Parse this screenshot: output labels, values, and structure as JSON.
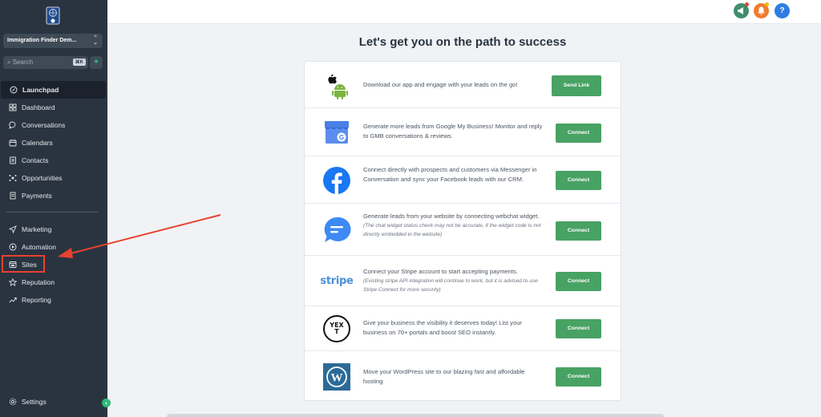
{
  "sidebar": {
    "account_name": "Immigration Finder Dem...",
    "search_placeholder": "Search",
    "search_shortcut": "⌘K",
    "nav_primary": [
      {
        "label": "Launchpad",
        "icon": "rocket-icon",
        "active": true
      },
      {
        "label": "Dashboard",
        "icon": "dashboard-icon"
      },
      {
        "label": "Conversations",
        "icon": "chat-icon"
      },
      {
        "label": "Calendars",
        "icon": "calendar-icon"
      },
      {
        "label": "Contacts",
        "icon": "contacts-icon"
      },
      {
        "label": "Opportunities",
        "icon": "opportunities-icon"
      },
      {
        "label": "Payments",
        "icon": "payments-icon"
      }
    ],
    "nav_secondary": [
      {
        "label": "Marketing",
        "icon": "send-icon"
      },
      {
        "label": "Automation",
        "icon": "automation-icon"
      },
      {
        "label": "Sites",
        "icon": "sites-icon",
        "highlighted": true
      },
      {
        "label": "Reputation",
        "icon": "star-icon"
      },
      {
        "label": "Reporting",
        "icon": "trend-icon"
      }
    ],
    "settings_label": "Settings"
  },
  "topbar": {
    "icons": [
      "megaphone-icon",
      "bell-icon",
      "help-icon"
    ],
    "help_label": "?"
  },
  "main": {
    "heading": "Let's get you on the path to success",
    "integrations": [
      {
        "logo": "apple-android-logo",
        "text": "Download our app and engage with your leads on the go!",
        "note": "",
        "button": "Send Link"
      },
      {
        "logo": "google-my-business-logo",
        "text": "Generate more leads from Google My Business! Monitor and reply to GMB conversations & reviews.",
        "note": "",
        "button": "Connect"
      },
      {
        "logo": "facebook-logo",
        "text": "Connect directly with prospects and customers via Messenger in Conversation and sync your Facebook leads with our CRM.",
        "note": "",
        "button": "Connect"
      },
      {
        "logo": "webchat-logo",
        "text": "Generate leads from your website by connecting webchat widget.",
        "note": "(The chat widget status check may not be accurate, if the widget code is not directly embedded in the website)",
        "button": "Connect"
      },
      {
        "logo": "stripe-logo",
        "logo_text": "stripe",
        "text": "Connect your Stripe account to start accepting payments.",
        "note": "(Existing stripe API integration will continue to work, but it is advised to use Stripe Connect for more security)",
        "button": "Connect"
      },
      {
        "logo": "yext-logo",
        "logo_text": "YEXT",
        "text": "Give your business the visibility it deserves today! List your business on 70+ portals and boost SEO instantly.",
        "note": "",
        "button": "Connect"
      },
      {
        "logo": "wordpress-logo",
        "text": "Move your WordPress site to our blazing fast and affordable hosting",
        "note": "",
        "button": "Connect"
      }
    ]
  },
  "colors": {
    "sidebar_bg": "#2a3441",
    "accent_green": "#48a263",
    "annotation_red": "#e8412e"
  }
}
